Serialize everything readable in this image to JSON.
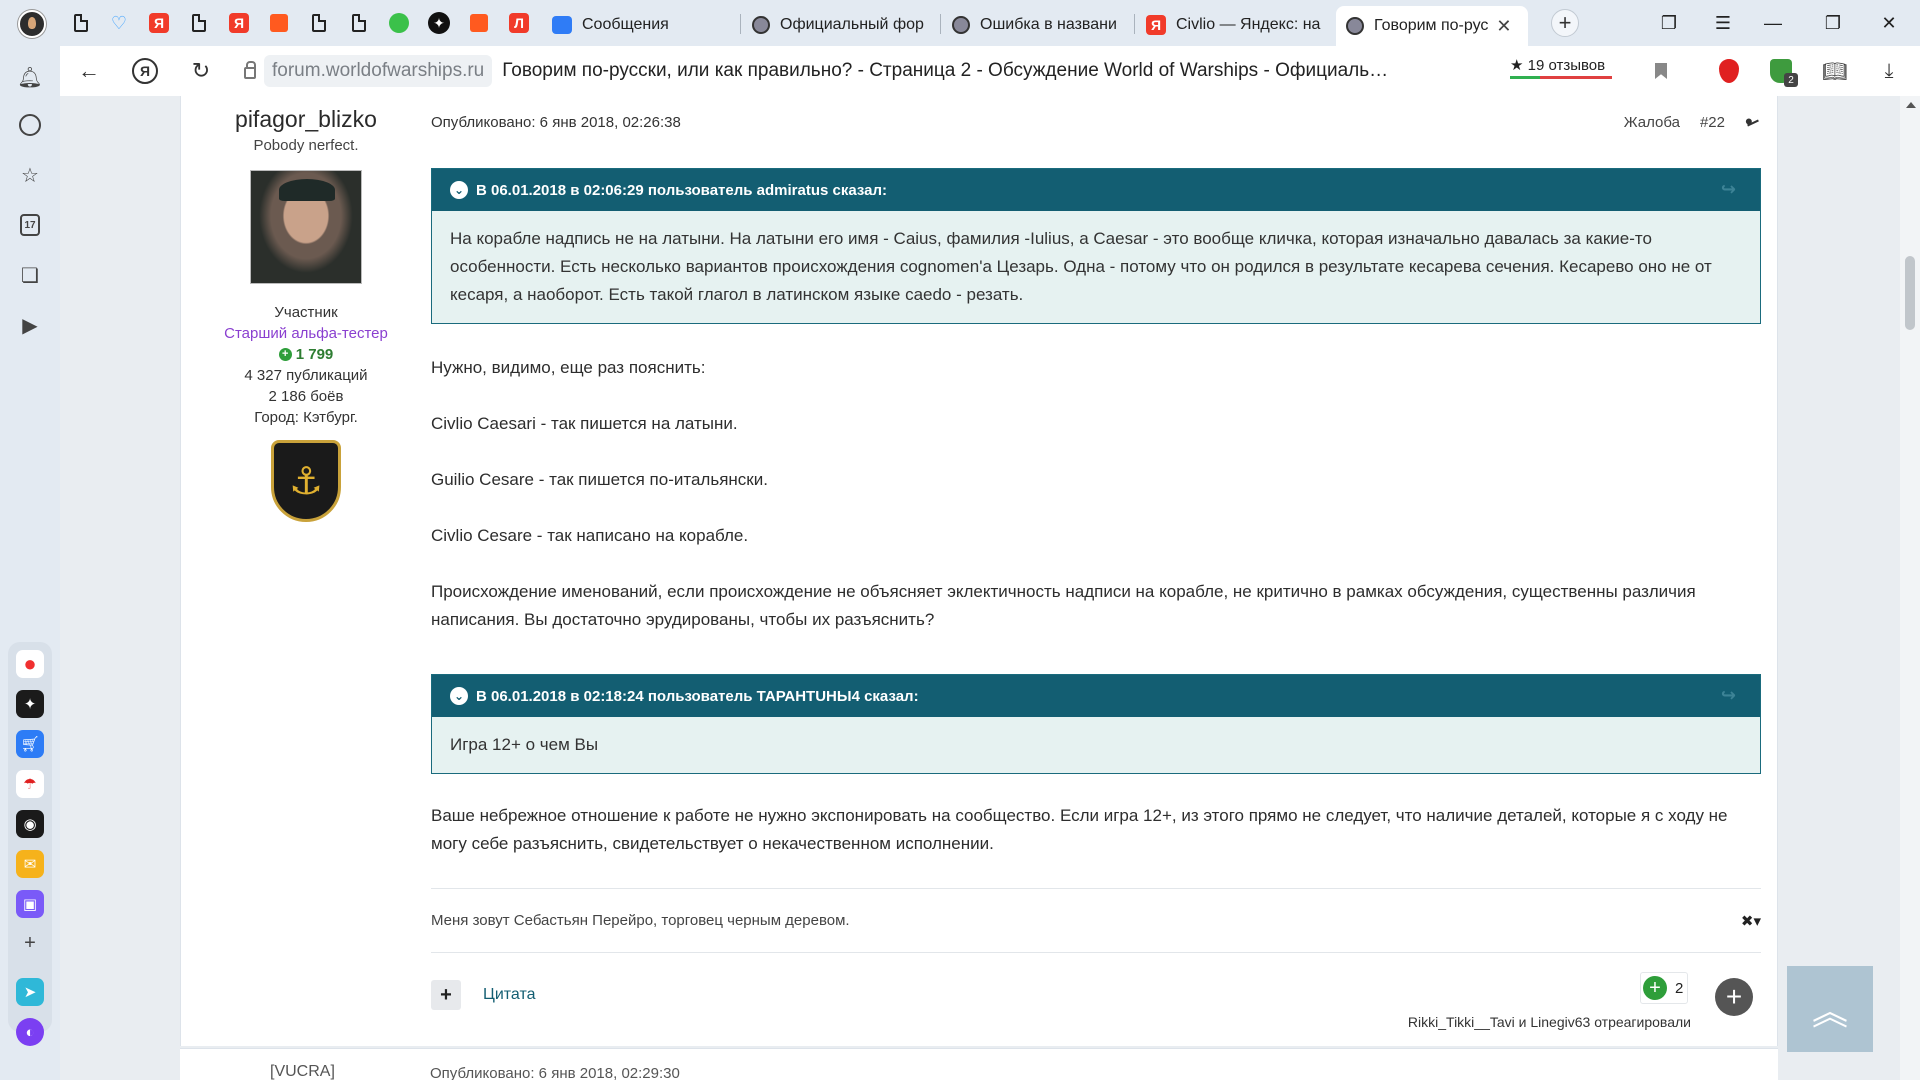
{
  "tabs": [
    {
      "label": "Сообщения"
    },
    {
      "label": "Официальный фор"
    },
    {
      "label": "Ошибка в названи"
    },
    {
      "label": "Civlio — Яндекс: на"
    },
    {
      "label": "Говорим по-рус",
      "active": true
    }
  ],
  "address_bar": {
    "domain": "forum.worldofwarships.ru",
    "page_title": "Говорим по-русски, или как правильно? - Страница 2 - Обсуждение World of Warships - Официаль…",
    "reviews": "★ 19 отзывов"
  },
  "sidebar": {
    "calendar_day": "17"
  },
  "author": {
    "name": "pifagor_blizko",
    "tagline": "Pobody nerfect.",
    "role": "Участник",
    "group": "Старший альфа-тестер",
    "reputation": "1 799",
    "posts": "4 327 публикаций",
    "battles": "2 186 боёв",
    "city": "Город: Кэтбург."
  },
  "post": {
    "published": "Опубликовано: 6 янв 2018, 02:26:38",
    "report": "Жалоба",
    "number": "#22",
    "quote1": {
      "header": "В 06.01.2018 в 02:06:29 пользователь admiratus сказал:",
      "text": "На корабле надпись не на латыни. На латыни его имя - Caius, фамилия -Iulius, а Caesar - это вообще кличка, которая изначально давалась за какие-то особенности. Есть несколько вариантов происхождения cognomen'a Цезарь. Одна - потому что он родился в результате кесарева сечения. Кесарево оно не от кесаря, а наоборот. Есть такой глагол в латинском языке caedo - резать."
    },
    "paragraphs": [
      "Нужно, видимо, еще раз пояснить:",
      "Civlio Caesari - так пишется на латыни.",
      "Guilio Cesare - так пишется по-итальянски.",
      "Civlio Cesare - так написано на корабле.",
      "Происхождение именований, если происхождение не объясняет эклектичность надписи на корабле, не критично в рамках обсуждения, существенны различия написания. Вы достаточно эрудированы, чтобы их разъяснить?"
    ],
    "quote2": {
      "header": "В 06.01.2018 в 02:18:24 пользователь ТАРАНТUНЫ4 сказал:",
      "text": "Игра 12+ о чем Вы"
    },
    "closing": "Ваше небрежное отношение к работе не нужно экспонировать на сообщество. Если игра 12+, из этого прямо не следует, что наличие деталей, которые я с ходу не могу себе разъяснить, свидетельствует о некачественном исполнении.",
    "signature": "Меня зовут Себастьян Перейро, торговец черным деревом.",
    "signature_toggle": "✖▾",
    "quote_button": "Цитата",
    "reaction_count": "2",
    "reacted_by": "Rikki_Tikki__Tavi и Linegiv63 отреагировали"
  },
  "next_post": {
    "author": "[VUCRA]",
    "meta": "Опубликовано: 6 янв 2018, 02:29:30"
  }
}
